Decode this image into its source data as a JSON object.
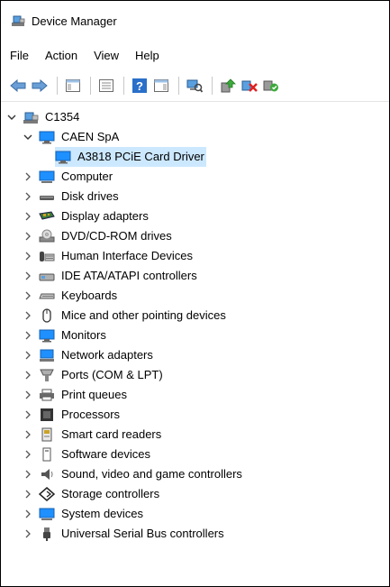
{
  "window": {
    "title": "Device Manager",
    "app_icon": "device-manager-icon"
  },
  "menu": [
    {
      "label": "File"
    },
    {
      "label": "Action"
    },
    {
      "label": "View"
    },
    {
      "label": "Help"
    }
  ],
  "toolbar": {
    "buttons": [
      {
        "icon": "back-arrow-icon"
      },
      {
        "icon": "forward-arrow-icon"
      },
      {
        "icon": "show-hide-console-tree-icon"
      },
      {
        "icon": "properties-icon"
      },
      {
        "icon": "help-icon"
      },
      {
        "icon": "action-pane-icon"
      },
      {
        "icon": "scan-hardware-icon"
      },
      {
        "icon": "update-driver-icon"
      },
      {
        "icon": "uninstall-device-icon"
      },
      {
        "icon": "enable-device-icon"
      }
    ]
  },
  "tree": {
    "root": {
      "label": "C1354",
      "icon": "computer-root-icon",
      "expanded": true
    },
    "items": [
      {
        "label": "CAEN SpA",
        "icon": "monitor-icon",
        "level": 1,
        "expanded": true
      },
      {
        "label": "A3818 PCiE Card Driver",
        "icon": "monitor-icon",
        "level": 2,
        "selected": true
      },
      {
        "label": "Computer",
        "icon": "computer-icon",
        "level": 1
      },
      {
        "label": "Disk drives",
        "icon": "disk-drive-icon",
        "level": 1
      },
      {
        "label": "Display adapters",
        "icon": "display-adapter-icon",
        "level": 1
      },
      {
        "label": "DVD/CD-ROM drives",
        "icon": "dvd-drive-icon",
        "level": 1
      },
      {
        "label": "Human Interface Devices",
        "icon": "hid-icon",
        "level": 1
      },
      {
        "label": "IDE ATA/ATAPI controllers",
        "icon": "ide-controller-icon",
        "level": 1
      },
      {
        "label": "Keyboards",
        "icon": "keyboard-icon",
        "level": 1
      },
      {
        "label": "Mice and other pointing devices",
        "icon": "mouse-icon",
        "level": 1
      },
      {
        "label": "Monitors",
        "icon": "monitor-icon",
        "level": 1
      },
      {
        "label": "Network adapters",
        "icon": "network-adapter-icon",
        "level": 1
      },
      {
        "label": "Ports (COM & LPT)",
        "icon": "port-icon",
        "level": 1
      },
      {
        "label": "Print queues",
        "icon": "printer-icon",
        "level": 1
      },
      {
        "label": "Processors",
        "icon": "processor-icon",
        "level": 1
      },
      {
        "label": "Smart card readers",
        "icon": "smart-card-reader-icon",
        "level": 1
      },
      {
        "label": "Software devices",
        "icon": "software-device-icon",
        "level": 1
      },
      {
        "label": "Sound, video and game controllers",
        "icon": "speaker-icon",
        "level": 1
      },
      {
        "label": "Storage controllers",
        "icon": "storage-controller-icon",
        "level": 1
      },
      {
        "label": "System devices",
        "icon": "system-device-icon",
        "level": 1
      },
      {
        "label": "Universal Serial Bus controllers",
        "icon": "usb-icon",
        "level": 1
      }
    ]
  },
  "colors": {
    "selection": "#cce8ff",
    "monitor_blue": "#1e90ff"
  }
}
